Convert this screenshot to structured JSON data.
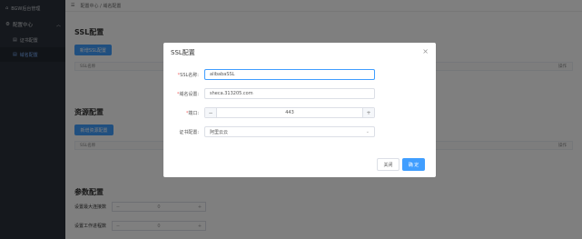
{
  "sidebar": {
    "logo_text": "BGW后台管理",
    "menu_label": "配置中心",
    "items": [
      {
        "label": "证书配置"
      },
      {
        "label": "域名配置"
      }
    ]
  },
  "topbar": {
    "breadcrumb_root": "配置中心",
    "breadcrumb_sep": "/",
    "breadcrumb_current": "域名配置"
  },
  "page": {
    "ssl_title": "SSL配置",
    "ssl_add_button": "新增SSL配置",
    "ssl_table_col1": "SSL名称",
    "ssl_table_col_op": "操作",
    "res_title": "资源配置",
    "res_add_button": "新增资源配置",
    "res_table_col1": "SSL名称",
    "res_table_col_op": "操作",
    "param_title": "参数配置",
    "param_rows": [
      {
        "label": "设置最大连接数",
        "value": "0"
      },
      {
        "label": "设置工作进程数",
        "value": "0"
      }
    ]
  },
  "modal": {
    "title": "SSL配置",
    "close_glyph": "×",
    "fields": {
      "name_label": "SSL名称:",
      "name_value": "alibabaSSL",
      "domain_label": "域名设置:",
      "domain_value": "sheca.313205.com",
      "port_label": "端口:",
      "port_value": "443",
      "cert_label": "证书配置:",
      "cert_value": "阿里云云"
    },
    "cancel_label": "关闭",
    "ok_label": "确 定"
  },
  "colors": {
    "accent": "#409eff",
    "sidebar_bg": "#2b313a",
    "required": "#f56c6c"
  }
}
